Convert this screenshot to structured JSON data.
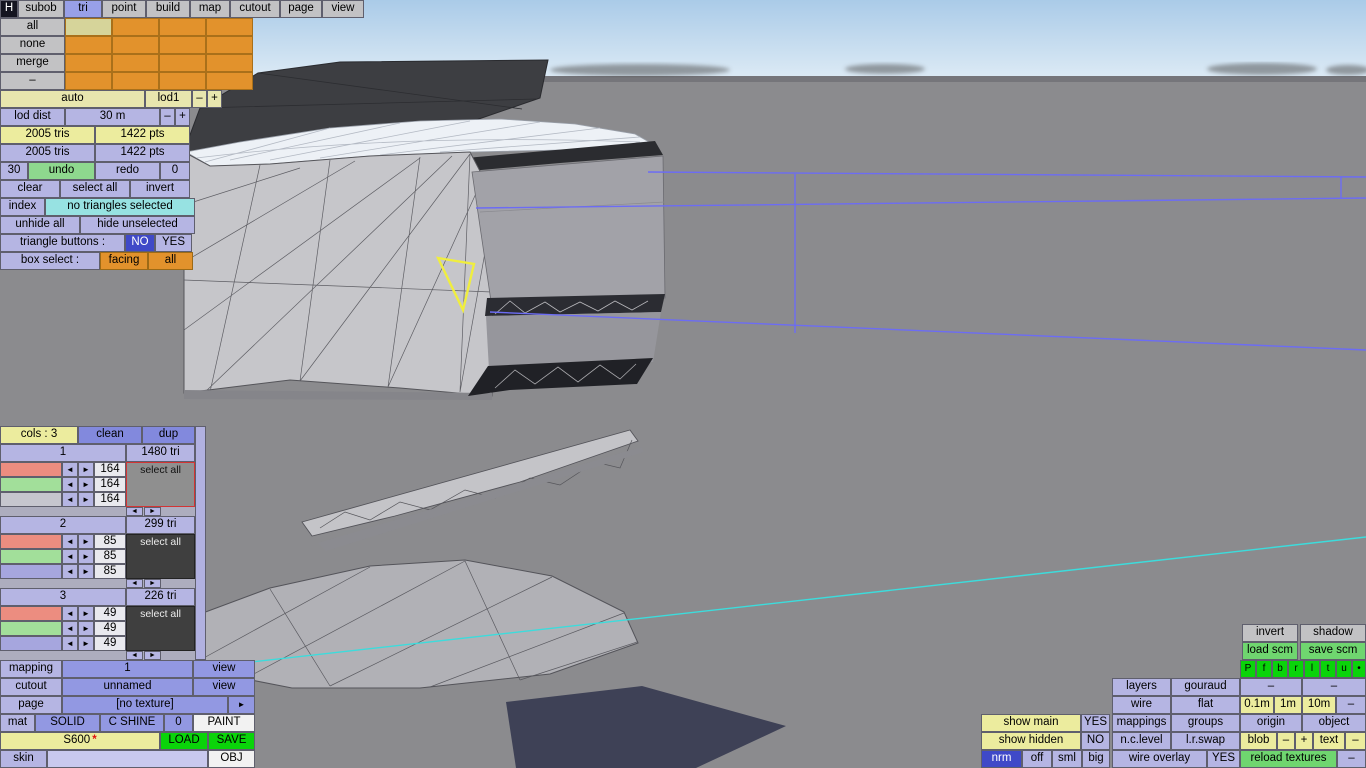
{
  "colors": {
    "lavender": "#b5b5e3",
    "yellow": "#ecec9e",
    "cyan_status": "#97e2e2",
    "orange": "#e2922c",
    "green_button": "#8ed88e",
    "bright_green": "#0ad40a",
    "mid_blue": "#9298e2",
    "dark_blue": "#3f49c8",
    "selection_wire": "#6c6cf4",
    "guide_line": "#3cdcdc",
    "highlight_triangle": "#f0ee3e"
  },
  "top_tabs": {
    "h": "H",
    "subob": "subob",
    "tri": "tri",
    "point": "point",
    "build": "build",
    "map": "map",
    "cutout": "cutout",
    "page": "page",
    "view": "view"
  },
  "palette": {
    "buttons": [
      "all",
      "none",
      "merge",
      "–"
    ]
  },
  "left": {
    "auto": "auto",
    "lod": "lod1",
    "lod_minus": "–",
    "lod_plus": "+",
    "lod_dist_label": "lod dist",
    "lod_dist_value": "30 m",
    "lod_dist_minus": "–",
    "lod_dist_plus": "+",
    "tris_count": "2005 tris",
    "pts_count": "1422 pts",
    "tris_count2": "2005 tris",
    "pts_count2": "1422 pts",
    "undo_steps": "30",
    "undo": "undo",
    "redo": "redo",
    "redo_steps": "0",
    "clear": "clear",
    "select_all": "select all",
    "invert": "invert",
    "index": "index",
    "selection_status": "no triangles selected",
    "unhide_all": "unhide all",
    "hide_unselected": "hide unselected",
    "triangle_buttons_label": "triangle buttons :",
    "triangle_buttons_no": "NO",
    "triangle_buttons_yes": "YES",
    "box_select_label": "box select :",
    "box_select_facing": "facing",
    "box_select_all": "all"
  },
  "groups_panel": {
    "cols": "cols : 3",
    "clean": "clean",
    "dup": "dup",
    "arrow_left": "◄",
    "arrow_right": "►",
    "groups": [
      {
        "id": "1",
        "tri_count": "1480 tri",
        "r": "164",
        "g": "164",
        "b": "164",
        "select_all": "select all"
      },
      {
        "id": "2",
        "tri_count": "299 tri",
        "r": "85",
        "g": "85",
        "b": "85",
        "select_all": "select all"
      },
      {
        "id": "3",
        "tri_count": "226 tri",
        "r": "49",
        "g": "49",
        "b": "49",
        "select_all": "select all"
      }
    ]
  },
  "bottom_left": {
    "mapping_label": "mapping",
    "mapping_value": "1",
    "mapping_view": "view",
    "cutout_label": "cutout",
    "cutout_value": "unnamed",
    "cutout_view": "view",
    "page_label": "page",
    "page_value": "[no texture]",
    "page_next": "►",
    "mat_label": "mat",
    "mat_solid": "SOLID",
    "mat_cshine": "C SHINE",
    "mat_zero": "0",
    "mat_paint": "PAINT",
    "model_name": "S600",
    "model_modified": "*",
    "load": "LOAD",
    "save": "SAVE",
    "skin_label": "skin",
    "skin_value": "",
    "obj": "OBJ"
  },
  "bottom_right": {
    "invert": "invert",
    "shadow": "shadow",
    "load_scm": "load scm",
    "save_scm": "save scm",
    "view_buttons": [
      "P",
      "f",
      "b",
      "r",
      "l",
      "t",
      "u",
      "•"
    ],
    "dash_a": "–",
    "dash_b": "–",
    "grid_01": "0.1m",
    "grid_1": "1m",
    "grid_10": "10m",
    "grid_dash": "–",
    "origin": "origin",
    "object": "object",
    "blob": "blob",
    "blob_minus": "–",
    "blob_plus": "+",
    "text": "text",
    "text_dash": "–",
    "reload_textures": "reload textures",
    "reload_dash": "–",
    "layers": "layers",
    "gouraud": "gouraud",
    "wire": "wire",
    "flat": "flat",
    "mappings": "mappings",
    "groups": "groups",
    "nclevel": "n.c.level",
    "lrswap": "l.r.swap",
    "wire_overlay": "wire overlay",
    "wire_overlay_yes": "YES",
    "show_main": "show main",
    "show_main_yes": "YES",
    "show_hidden": "show hidden",
    "show_hidden_no": "NO",
    "nrm": "nrm",
    "nrm_off": "off",
    "nrm_sml": "sml",
    "nrm_big": "big"
  }
}
